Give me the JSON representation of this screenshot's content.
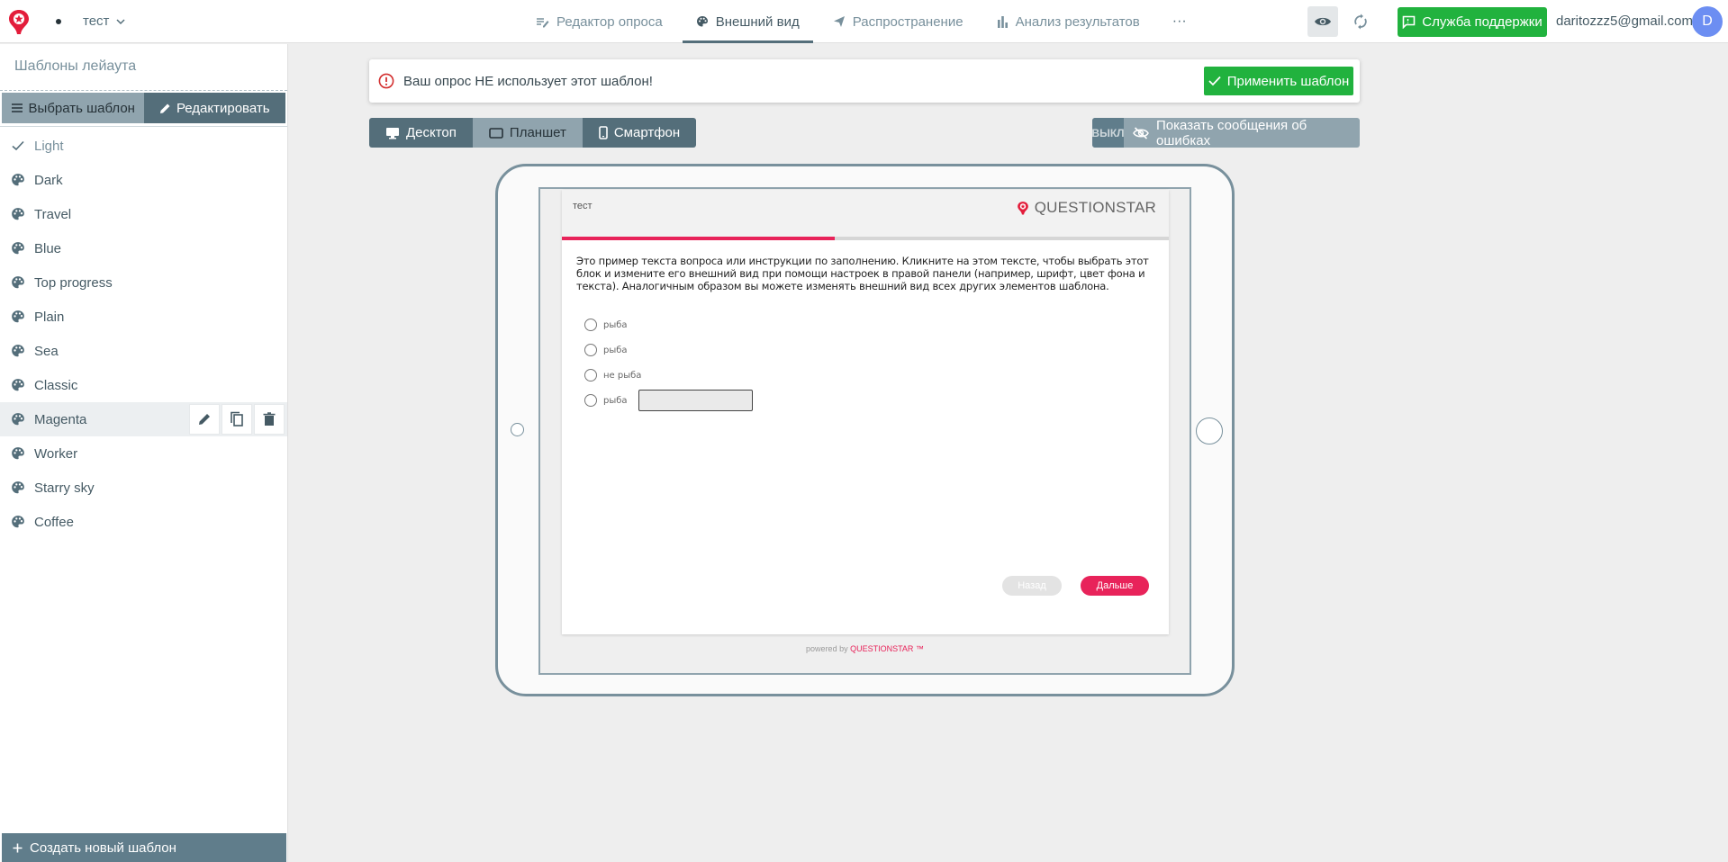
{
  "header": {
    "survey_name": "тест",
    "nav": [
      {
        "label": "Редактор опроса"
      },
      {
        "label": "Внешний вид"
      },
      {
        "label": "Распространение"
      },
      {
        "label": "Анализ результатов"
      }
    ],
    "more_label": "···",
    "support_label": "Служба поддержки",
    "user_email": "daritozzz5@gmail.com",
    "avatar_letter": "D"
  },
  "sidebar": {
    "title": "Шаблоны лейаута",
    "tab_select": "Выбрать шаблон",
    "tab_edit": "Редактировать",
    "templates": [
      {
        "name": "Light"
      },
      {
        "name": "Dark"
      },
      {
        "name": "Travel"
      },
      {
        "name": "Blue"
      },
      {
        "name": "Top progress"
      },
      {
        "name": "Plain"
      },
      {
        "name": "Sea"
      },
      {
        "name": "Classic"
      },
      {
        "name": "Magenta"
      },
      {
        "name": "Worker"
      },
      {
        "name": "Starry sky"
      },
      {
        "name": "Coffee"
      }
    ],
    "current_template": "Light",
    "hovered_template": "Magenta",
    "create_label": "Создать новый шаблон"
  },
  "notice": {
    "text": "Ваш опрос НЕ использует этот шаблон!",
    "apply_label": "Применить шаблон"
  },
  "devices": {
    "desktop": "Десктоп",
    "tablet": "Планшет",
    "phone": "Смартфон",
    "active": "Планшет"
  },
  "errors_toggle": {
    "state_label": "ВЫКЛ",
    "label": "Показать сообщения об ошибках"
  },
  "preview": {
    "survey_name": "тест",
    "brand": "QUESTIONSTAR",
    "progress": 0.45,
    "question_text": "Это пример текста вопроса или инструкции по заполнению. Кликните на этом тексте, чтобы выбрать этот блок и измените его внешний вид при помощи настроек в правой панели (например, шрифт, цвет фона и текста). Аналогичным образом вы можете изменять внешний вид всех других элементов шаблона.",
    "options": [
      {
        "label": "рыба"
      },
      {
        "label": "рыба"
      },
      {
        "label": "не рыба"
      },
      {
        "label": "рыба"
      }
    ],
    "back_label": "Назад",
    "next_label": "Дальше",
    "powered_prefix": "powered by",
    "powered_brand": "QUESTIONSTAR ™"
  },
  "colors": {
    "accent_green": "#21b23e",
    "brand_magenta": "#e8235a",
    "slate": "#546e7a",
    "slate_light": "#90a4ae"
  }
}
